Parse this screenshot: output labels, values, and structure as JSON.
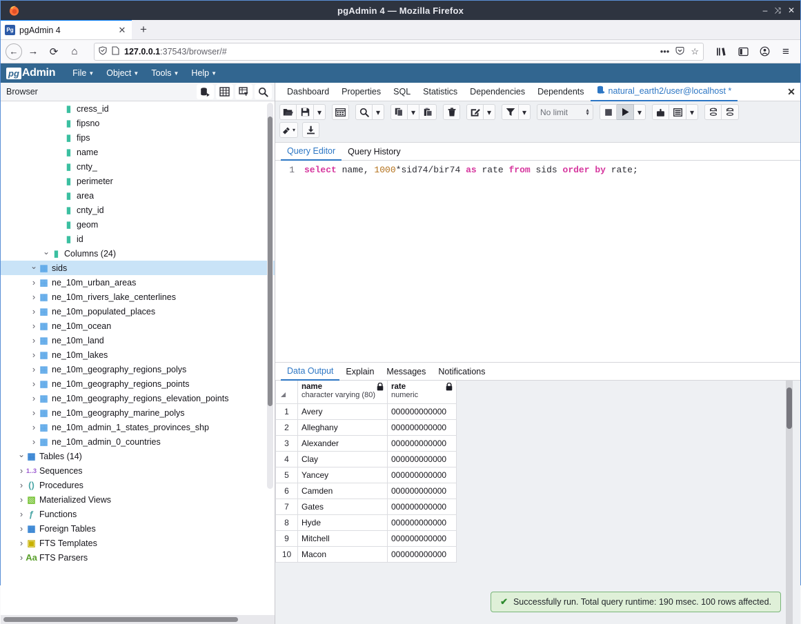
{
  "window": {
    "title": "pgAdmin 4 — Mozilla Firefox",
    "minimize": "–",
    "restore": "⤨",
    "close": "✕",
    "logo_icon": "firefox-icon"
  },
  "browser_chrome": {
    "tab": {
      "favicon_text": "Pg",
      "label": "pgAdmin 4",
      "close": "✕"
    },
    "new_tab": "+",
    "back": "←",
    "forward": "→",
    "reload": "⟳",
    "home": "⌂",
    "url": {
      "shield": "Ⓥ",
      "page_icon": "὜E",
      "host": "127.0.0.1",
      "path": ":37543/browser/#"
    },
    "url_actions": {
      "more": "•••",
      "pocket": "Ⓥ",
      "bookmark": "☆"
    },
    "right_icons": {
      "library": "‖\\",
      "sidebar": "▣",
      "account": "ⓘ",
      "menu": "≡"
    }
  },
  "pgadmin": {
    "logo_mark": "pg",
    "logo_word": "Admin",
    "menus": [
      "File",
      "Object",
      "Tools",
      "Help"
    ]
  },
  "browser_panel": {
    "title": "Browser",
    "tools": [
      "object-explorer-icon",
      "grid-icon",
      "filter-table-icon",
      "search-icon"
    ],
    "tree": [
      {
        "label": "FTS Parsers",
        "state": "closed",
        "indent": 1,
        "icon": "fts-parser-icon",
        "glyph": "Aa",
        "color": "#5aa02c"
      },
      {
        "label": "FTS Templates",
        "state": "closed",
        "indent": 1,
        "icon": "fts-template-icon",
        "glyph": "▣",
        "color": "#c8b100"
      },
      {
        "label": "Foreign Tables",
        "state": "closed",
        "indent": 1,
        "icon": "foreign-table-icon",
        "glyph": "▦",
        "color": "#2f7fd1"
      },
      {
        "label": "Functions",
        "state": "closed",
        "indent": 1,
        "icon": "function-icon",
        "glyph": "ƒ",
        "color": "#4aa6a6"
      },
      {
        "label": "Materialized Views",
        "state": "closed",
        "indent": 1,
        "icon": "mview-icon",
        "glyph": "▧",
        "color": "#6fbf2a"
      },
      {
        "label": "Procedures",
        "state": "closed",
        "indent": 1,
        "icon": "procedure-icon",
        "glyph": "()",
        "color": "#4aa6a6"
      },
      {
        "label": "Sequences",
        "state": "closed",
        "indent": 1,
        "icon": "sequence-icon",
        "glyph": "1..3",
        "color": "#9b59d0"
      },
      {
        "label": "Tables (14)",
        "state": "open",
        "indent": 1,
        "icon": "tables-icon",
        "glyph": "▦",
        "color": "#2f7fd1"
      },
      {
        "label": "ne_10m_admin_0_countries",
        "state": "closed",
        "indent": 2,
        "icon": "table-icon",
        "glyph": "▦",
        "color": "#5ba7e8"
      },
      {
        "label": "ne_10m_admin_1_states_provinces_shp",
        "state": "closed",
        "indent": 2,
        "icon": "table-icon",
        "glyph": "▦",
        "color": "#5ba7e8"
      },
      {
        "label": "ne_10m_geography_marine_polys",
        "state": "closed",
        "indent": 2,
        "icon": "table-icon",
        "glyph": "▦",
        "color": "#5ba7e8"
      },
      {
        "label": "ne_10m_geography_regions_elevation_points",
        "state": "closed",
        "indent": 2,
        "icon": "table-icon",
        "glyph": "▦",
        "color": "#5ba7e8"
      },
      {
        "label": "ne_10m_geography_regions_points",
        "state": "closed",
        "indent": 2,
        "icon": "table-icon",
        "glyph": "▦",
        "color": "#5ba7e8"
      },
      {
        "label": "ne_10m_geography_regions_polys",
        "state": "closed",
        "indent": 2,
        "icon": "table-icon",
        "glyph": "▦",
        "color": "#5ba7e8"
      },
      {
        "label": "ne_10m_lakes",
        "state": "closed",
        "indent": 2,
        "icon": "table-icon",
        "glyph": "▦",
        "color": "#5ba7e8"
      },
      {
        "label": "ne_10m_land",
        "state": "closed",
        "indent": 2,
        "icon": "table-icon",
        "glyph": "▦",
        "color": "#5ba7e8"
      },
      {
        "label": "ne_10m_ocean",
        "state": "closed",
        "indent": 2,
        "icon": "table-icon",
        "glyph": "▦",
        "color": "#5ba7e8"
      },
      {
        "label": "ne_10m_populated_places",
        "state": "closed",
        "indent": 2,
        "icon": "table-icon",
        "glyph": "▦",
        "color": "#5ba7e8"
      },
      {
        "label": "ne_10m_rivers_lake_centerlines",
        "state": "closed",
        "indent": 2,
        "icon": "table-icon",
        "glyph": "▦",
        "color": "#5ba7e8"
      },
      {
        "label": "ne_10m_urban_areas",
        "state": "closed",
        "indent": 2,
        "icon": "table-icon",
        "glyph": "▦",
        "color": "#5ba7e8"
      },
      {
        "label": "sids",
        "state": "open",
        "indent": 2,
        "icon": "table-icon",
        "glyph": "▦",
        "color": "#5ba7e8",
        "selected": true
      },
      {
        "label": "Columns (24)",
        "state": "open",
        "indent": 3,
        "icon": "columns-icon",
        "glyph": "▮",
        "color": "#3bbfa0"
      },
      {
        "label": "id",
        "state": "leaf",
        "indent": 4,
        "icon": "column-icon",
        "glyph": "▮",
        "color": "#3bbfa0"
      },
      {
        "label": "geom",
        "state": "leaf",
        "indent": 4,
        "icon": "column-icon",
        "glyph": "▮",
        "color": "#3bbfa0"
      },
      {
        "label": "cnty_id",
        "state": "leaf",
        "indent": 4,
        "icon": "column-icon",
        "glyph": "▮",
        "color": "#3bbfa0"
      },
      {
        "label": "area",
        "state": "leaf",
        "indent": 4,
        "icon": "column-icon",
        "glyph": "▮",
        "color": "#3bbfa0"
      },
      {
        "label": "perimeter",
        "state": "leaf",
        "indent": 4,
        "icon": "column-icon",
        "glyph": "▮",
        "color": "#3bbfa0"
      },
      {
        "label": "cnty_",
        "state": "leaf",
        "indent": 4,
        "icon": "column-icon",
        "glyph": "▮",
        "color": "#3bbfa0"
      },
      {
        "label": "name",
        "state": "leaf",
        "indent": 4,
        "icon": "column-icon",
        "glyph": "▮",
        "color": "#3bbfa0"
      },
      {
        "label": "fips",
        "state": "leaf",
        "indent": 4,
        "icon": "column-icon",
        "glyph": "▮",
        "color": "#3bbfa0"
      },
      {
        "label": "fipsno",
        "state": "leaf",
        "indent": 4,
        "icon": "column-icon",
        "glyph": "▮",
        "color": "#3bbfa0"
      },
      {
        "label": "cress_id",
        "state": "leaf",
        "indent": 4,
        "icon": "column-icon",
        "glyph": "▮",
        "color": "#3bbfa0"
      }
    ]
  },
  "object_tabs": {
    "tabs": [
      "Dashboard",
      "Properties",
      "SQL",
      "Statistics",
      "Dependencies",
      "Dependents"
    ],
    "active_session": "natural_earth2/user@localhost *",
    "session_icon": "database-icon",
    "close": "✕"
  },
  "query_toolbar": {
    "row1": [
      {
        "name": "open-file-button",
        "glyph": "📂",
        "kind": "btn"
      },
      {
        "name": "save-file-button",
        "glyph": "💾",
        "kind": "btn"
      },
      {
        "name": "save-options-caret",
        "glyph": "⌄",
        "kind": "caret"
      },
      {
        "name": "edit-grid-button",
        "glyph": "▦",
        "kind": "btn"
      },
      {
        "name": "find-button",
        "glyph": "🔍",
        "kind": "btn"
      },
      {
        "name": "find-options-caret",
        "glyph": "⌄",
        "kind": "caret"
      },
      {
        "name": "copy-button",
        "glyph": "❐",
        "kind": "btn"
      },
      {
        "name": "copy-options-caret",
        "glyph": "⌄",
        "kind": "caret"
      },
      {
        "name": "paste-button",
        "glyph": "❑",
        "kind": "btn"
      },
      {
        "name": "delete-row-button",
        "glyph": "🗑",
        "kind": "btn"
      },
      {
        "name": "edit-button",
        "glyph": "✎",
        "kind": "btn"
      },
      {
        "name": "edit-options-caret",
        "glyph": "⌄",
        "kind": "caret"
      },
      {
        "name": "filter-button",
        "glyph": "▼",
        "kind": "btn"
      },
      {
        "name": "filter-options-caret",
        "glyph": "⌄",
        "kind": "caret"
      }
    ],
    "row_limit": {
      "label": "No limit",
      "up": "▲",
      "down": "▼"
    },
    "run_group": [
      {
        "name": "stop-button",
        "glyph": "■",
        "kind": "btn"
      },
      {
        "name": "execute-button",
        "glyph": "▶",
        "kind": "btn",
        "active": true
      },
      {
        "name": "execute-options-caret",
        "glyph": "⌄",
        "kind": "caret"
      }
    ],
    "explain_group": [
      {
        "name": "explain-button",
        "glyph": "☚",
        "kind": "btn"
      },
      {
        "name": "explain-analyze-button",
        "glyph": "☷",
        "kind": "btn"
      },
      {
        "name": "explain-options-caret",
        "glyph": "⌄",
        "kind": "caret"
      }
    ],
    "transaction_group": [
      {
        "name": "commit-button",
        "glyph": "↻",
        "kind": "btn"
      },
      {
        "name": "rollback-button",
        "glyph": "↺",
        "kind": "btn"
      }
    ],
    "row2": [
      {
        "name": "macros-button",
        "glyph": "◆",
        "kind": "btn"
      },
      {
        "name": "macros-caret",
        "glyph": "⌄",
        "kind": "caret"
      },
      {
        "name": "download-csv-button",
        "glyph": "↧",
        "kind": "btn"
      }
    ]
  },
  "editor": {
    "tabs": [
      "Query Editor",
      "Query History"
    ],
    "active_tab": "Query Editor",
    "line_number": "1",
    "sql_tokens": [
      {
        "t": "select",
        "c": "k"
      },
      {
        "t": " name, ",
        "c": "plain"
      },
      {
        "t": "1000",
        "c": "num"
      },
      {
        "t": "*sid74/bir74 ",
        "c": "plain"
      },
      {
        "t": "as",
        "c": "k"
      },
      {
        "t": " rate ",
        "c": "plain"
      },
      {
        "t": "from",
        "c": "k"
      },
      {
        "t": " sids ",
        "c": "plain"
      },
      {
        "t": "order",
        "c": "k"
      },
      {
        "t": " ",
        "c": "plain"
      },
      {
        "t": "by",
        "c": "k"
      },
      {
        "t": " rate;",
        "c": "plain"
      }
    ]
  },
  "results": {
    "tabs": [
      "Data Output",
      "Explain",
      "Messages",
      "Notifications"
    ],
    "active_tab": "Data Output",
    "columns": [
      {
        "name": "name",
        "type": "character varying (80)",
        "lock": "🔒"
      },
      {
        "name": "rate",
        "type": "numeric",
        "lock": "🔒"
      }
    ],
    "rows": [
      {
        "n": "1",
        "name": "Avery",
        "rate": "000000000000"
      },
      {
        "n": "2",
        "name": "Alleghany",
        "rate": "000000000000"
      },
      {
        "n": "3",
        "name": "Alexander",
        "rate": "000000000000"
      },
      {
        "n": "4",
        "name": "Clay",
        "rate": "000000000000"
      },
      {
        "n": "5",
        "name": "Yancey",
        "rate": "000000000000"
      },
      {
        "n": "6",
        "name": "Camden",
        "rate": "000000000000"
      },
      {
        "n": "7",
        "name": "Gates",
        "rate": "000000000000"
      },
      {
        "n": "8",
        "name": "Hyde",
        "rate": "000000000000"
      },
      {
        "n": "9",
        "name": "Mitchell",
        "rate": "000000000000"
      },
      {
        "n": "10",
        "name": "Macon",
        "rate": "000000000000"
      }
    ],
    "toast": {
      "check": "✔",
      "message": "Successfully run. Total query runtime: 190 msec. 100 rows affected."
    }
  }
}
